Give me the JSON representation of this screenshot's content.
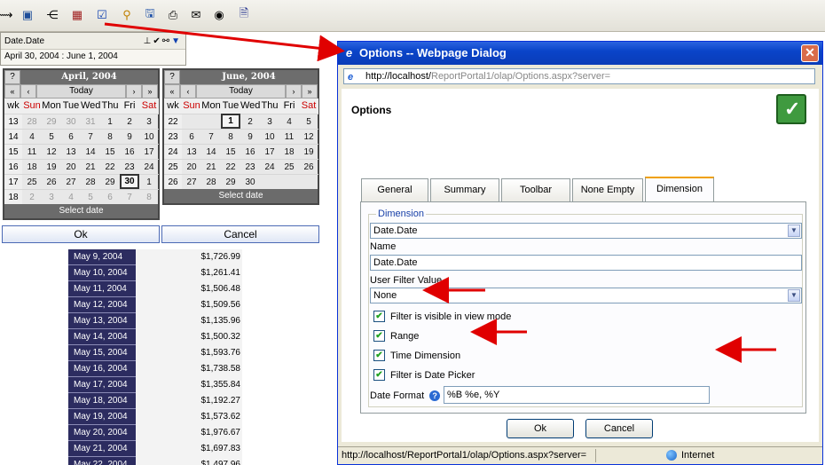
{
  "filter": {
    "label": "Date.Date",
    "value": "April 30, 2004 : June 1, 2004"
  },
  "calendar_april": {
    "month": "April, 2004",
    "today": "Today",
    "help": "?",
    "nav": [
      "«",
      "‹",
      "›",
      "»"
    ],
    "headers": [
      "wk",
      "Sun",
      "Mon",
      "Tue",
      "Wed",
      "Thu",
      "Fri",
      "Sat"
    ],
    "rows": [
      [
        "13",
        "28",
        "29",
        "30",
        "31",
        "1",
        "2",
        "3"
      ],
      [
        "14",
        "4",
        "5",
        "6",
        "7",
        "8",
        "9",
        "10"
      ],
      [
        "15",
        "11",
        "12",
        "13",
        "14",
        "15",
        "16",
        "17"
      ],
      [
        "16",
        "18",
        "19",
        "20",
        "21",
        "22",
        "23",
        "24"
      ],
      [
        "17",
        "25",
        "26",
        "27",
        "28",
        "29",
        "30",
        "1"
      ],
      [
        "18",
        "2",
        "3",
        "4",
        "5",
        "6",
        "7",
        "8"
      ]
    ],
    "footer": "Select date"
  },
  "calendar_june": {
    "month": "June, 2004",
    "today": "Today",
    "help": "?",
    "nav": [
      "«",
      "‹",
      "›",
      "»"
    ],
    "headers": [
      "wk",
      "Sun",
      "Mon",
      "Tue",
      "Wed",
      "Thu",
      "Fri",
      "Sat"
    ],
    "rows": [
      [
        "22",
        "",
        "",
        "1",
        "2",
        "3",
        "4",
        "5"
      ],
      [
        "23",
        "6",
        "7",
        "8",
        "9",
        "10",
        "11",
        "12"
      ],
      [
        "24",
        "13",
        "14",
        "15",
        "16",
        "17",
        "18",
        "19"
      ],
      [
        "25",
        "20",
        "21",
        "22",
        "23",
        "24",
        "25",
        "26"
      ],
      [
        "26",
        "27",
        "28",
        "29",
        "30",
        "",
        "",
        ""
      ]
    ],
    "footer": "Select date"
  },
  "calendar_buttons": {
    "ok": "Ok",
    "cancel": "Cancel"
  },
  "data_rows": [
    {
      "date": "May 9, 2004",
      "value": "$1,726.99"
    },
    {
      "date": "May 10, 2004",
      "value": "$1,261.41"
    },
    {
      "date": "May 11, 2004",
      "value": "$1,506.48"
    },
    {
      "date": "May 12, 2004",
      "value": "$1,509.56"
    },
    {
      "date": "May 13, 2004",
      "value": "$1,135.96"
    },
    {
      "date": "May 14, 2004",
      "value": "$1,500.32"
    },
    {
      "date": "May 15, 2004",
      "value": "$1,593.76"
    },
    {
      "date": "May 16, 2004",
      "value": "$1,738.58"
    },
    {
      "date": "May 17, 2004",
      "value": "$1,355.84"
    },
    {
      "date": "May 18, 2004",
      "value": "$1,192.27"
    },
    {
      "date": "May 19, 2004",
      "value": "$1,573.62"
    },
    {
      "date": "May 20, 2004",
      "value": "$1,976.67"
    },
    {
      "date": "May 21, 2004",
      "value": "$1,697.83"
    },
    {
      "date": "May 22, 2004",
      "value": "$1,497.96"
    }
  ],
  "dialog": {
    "title": "Options -- Webpage Dialog",
    "url_host": "http://localhost/",
    "url_rest": "ReportPortal1/olap/Options.aspx?server=",
    "heading": "Options",
    "tabs": [
      "General",
      "Summary",
      "Toolbar",
      "None Empty",
      "Dimension"
    ],
    "active_tab": "Dimension",
    "group_legend": "Dimension",
    "dimension_select": "Date.Date",
    "name_label": "Name",
    "name_value": "Date.Date",
    "user_filter_label": "User Filter Value",
    "user_filter_value": "None",
    "checks": [
      {
        "label": "Filter is visible in view mode",
        "checked": true
      },
      {
        "label": "Range",
        "checked": true
      },
      {
        "label": "Time Dimension",
        "checked": true
      },
      {
        "label": "Filter is Date Picker",
        "checked": true
      }
    ],
    "date_format_label": "Date Format",
    "date_format_value": "%B %e, %Y",
    "ok": "Ok",
    "cancel": "Cancel",
    "status_url": "http://localhost/ReportPortal1/olap/Options.aspx?server=",
    "status_zone": "Internet"
  },
  "colors": {
    "arrow": "#e00000",
    "title_bar": "#0a44c9",
    "calendar_dark": "#474747",
    "data_date_bg": "#2c2c60"
  }
}
